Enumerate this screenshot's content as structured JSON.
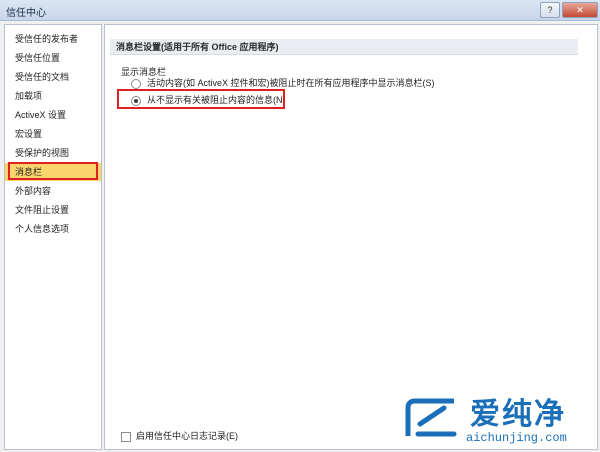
{
  "window": {
    "title": "信任中心",
    "help_label": "?",
    "close_label": "✕"
  },
  "sidebar": {
    "items": [
      {
        "label": "受信任的发布者"
      },
      {
        "label": "受信任位置"
      },
      {
        "label": "受信任的文档"
      },
      {
        "label": "加载项"
      },
      {
        "label": "ActiveX 设置"
      },
      {
        "label": "宏设置"
      },
      {
        "label": "受保护的视图"
      },
      {
        "label": "消息栏"
      },
      {
        "label": "外部内容"
      },
      {
        "label": "文件阻止设置"
      },
      {
        "label": "个人信息选项"
      }
    ],
    "selected_index": 7
  },
  "content": {
    "section_title": "消息栏设置(适用于所有 Office 应用程序)",
    "group_label": "显示消息栏",
    "options": [
      {
        "label": "活动内容(如 ActiveX 控件和宏)被阻止时在所有应用程序中显示消息栏(S)",
        "checked": false
      },
      {
        "label": "从不显示有关被阻止内容的信息(N)",
        "checked": true
      }
    ],
    "log_checkbox": {
      "label": "启用信任中心日志记录(E)",
      "checked": false
    }
  },
  "watermark": {
    "brand": "爱纯净",
    "url": "aichunjing.com"
  }
}
